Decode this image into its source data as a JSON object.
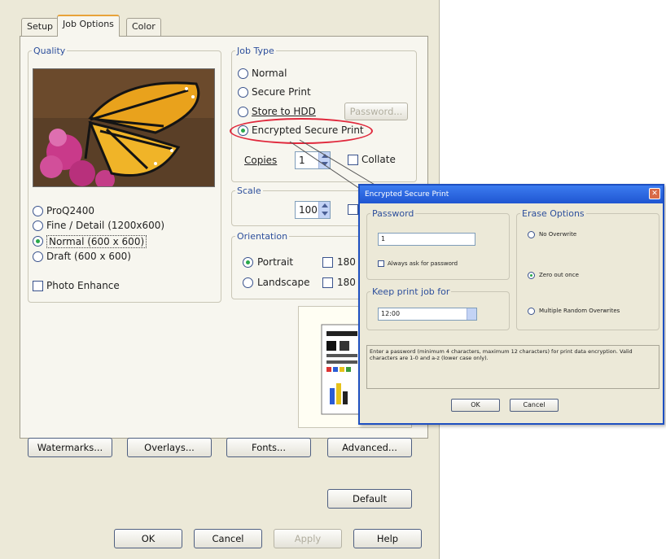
{
  "tabs": [
    {
      "label": "Setup",
      "active": false
    },
    {
      "label": "Job Options",
      "active": true
    },
    {
      "label": "Color",
      "active": false
    }
  ],
  "quality": {
    "legend": "Quality",
    "options": [
      {
        "label": "ProQ2400",
        "selected": false
      },
      {
        "label": "Fine / Detail (1200x600)",
        "selected": false
      },
      {
        "label": "Normal (600 x 600)",
        "selected": true
      },
      {
        "label": "Draft (600 x 600)",
        "selected": false
      }
    ],
    "photo_enhance": {
      "label": "Photo Enhance",
      "checked": false
    }
  },
  "job_type": {
    "legend": "Job Type",
    "options": [
      {
        "label": "Normal",
        "selected": false
      },
      {
        "label": "Secure Print",
        "selected": false
      },
      {
        "label": "Store to HDD",
        "selected": false
      },
      {
        "label": "Encrypted Secure Print",
        "selected": true
      }
    ],
    "password_button": "Password...",
    "copies_label": "Copies",
    "copies_value": "1",
    "collate_label": "Collate",
    "collate_checked": false
  },
  "scale": {
    "legend": "Scale",
    "value": "100"
  },
  "orientation": {
    "legend": "Orientation",
    "options": [
      {
        "label": "Portrait",
        "selected": true
      },
      {
        "label": "Landscape",
        "selected": false
      }
    ],
    "rotate_labels": [
      "180",
      "180"
    ]
  },
  "buttons": {
    "watermarks": "Watermarks...",
    "overlays": "Overlays...",
    "fonts": "Fonts...",
    "advanced": "Advanced...",
    "default": "Default",
    "ok": "OK",
    "cancel": "Cancel",
    "apply": "Apply",
    "help": "Help"
  },
  "dialog": {
    "title": "Encrypted Secure Print",
    "close_symbol": "✕",
    "password_legend": "Password",
    "password_value": "1",
    "always_ask_label": "Always ask for password",
    "keep_legend": "Keep print job for",
    "keep_value": "12:00",
    "erase_legend": "Erase Options",
    "erase_options": [
      {
        "label": "No Overwrite",
        "selected": false
      },
      {
        "label": "Zero out once",
        "selected": true
      },
      {
        "label": "Multiple Random Overwrites",
        "selected": false
      }
    ],
    "info_text": "Enter a password (minimum 4 characters, maximum 12 characters) for print data encryption. Valid characters are 1-0 and a-z (lower case only).",
    "ok": "OK",
    "cancel": "Cancel"
  },
  "colors": {
    "highlight": "#e0283c",
    "title_bar": "#2a62e0",
    "accent": "#2d4f9c"
  }
}
